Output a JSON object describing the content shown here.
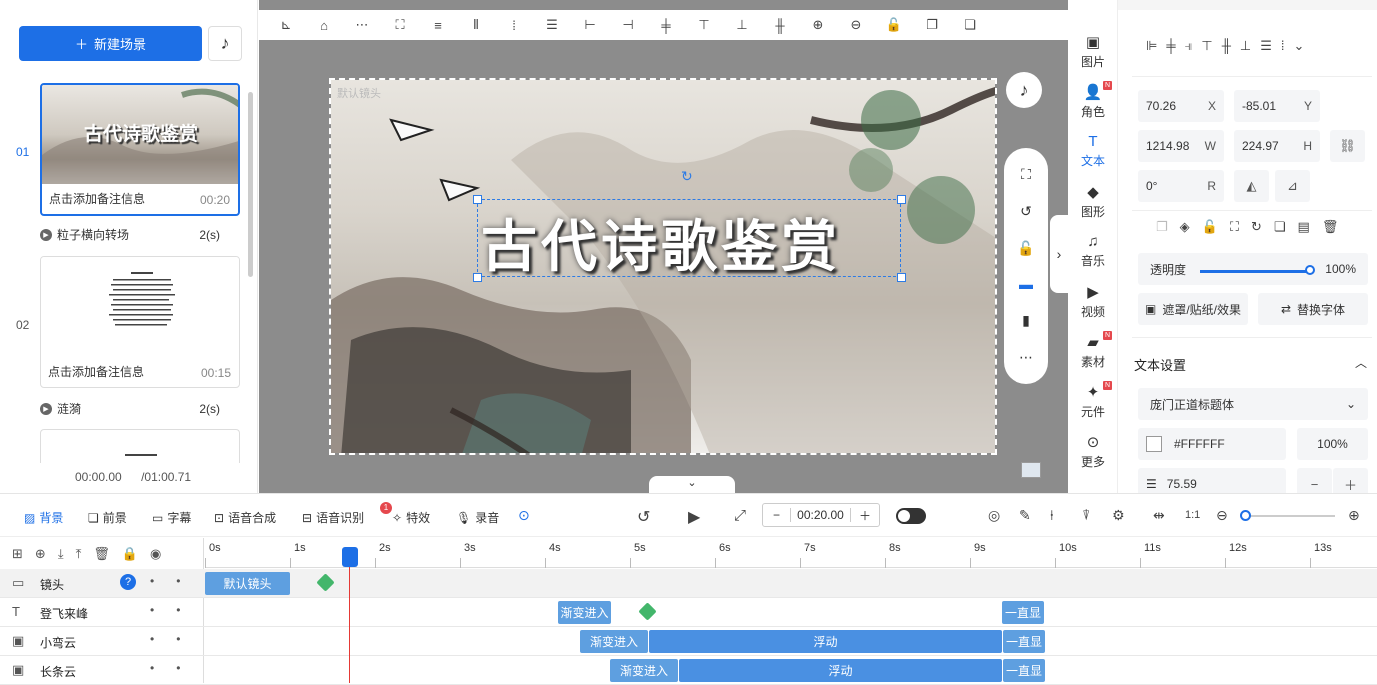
{
  "left": {
    "new_scene": "新建场景",
    "scenes": [
      {
        "num": "01",
        "title": "古代诗歌鉴赏",
        "note": "点击添加备注信息",
        "duration": "00:20"
      },
      {
        "num": "02",
        "note": "点击添加备注信息",
        "duration": "00:15"
      }
    ],
    "transitions": [
      {
        "name": "粒子横向转场",
        "duration": "2(s)"
      },
      {
        "name": "涟漪",
        "duration": "2(s)"
      }
    ],
    "time_current": "00:00.00",
    "time_total": "/01:00.71"
  },
  "canvas": {
    "camera_label": "默认镜头",
    "title_text": "古代诗歌鉴赏"
  },
  "categories": [
    {
      "label": "图片",
      "icon": "image-icon"
    },
    {
      "label": "角色",
      "icon": "person-icon",
      "badge": "N"
    },
    {
      "label": "文本",
      "icon": "text-icon",
      "active": true
    },
    {
      "label": "图形",
      "icon": "shape-icon"
    },
    {
      "label": "音乐",
      "icon": "music-icon"
    },
    {
      "label": "视频",
      "icon": "video-icon"
    },
    {
      "label": "素材",
      "icon": "folder-icon",
      "badge": "N"
    },
    {
      "label": "元件",
      "icon": "component-icon",
      "badge": "N"
    },
    {
      "label": "更多",
      "icon": "more-icon"
    }
  ],
  "props": {
    "x": "70.26",
    "x_unit": "X",
    "y": "-85.01",
    "y_unit": "Y",
    "w": "1214.98",
    "w_unit": "W",
    "h": "224.97",
    "h_unit": "H",
    "r": "0°",
    "r_unit": "R",
    "opacity_label": "透明度",
    "opacity_value": "100%",
    "opacity_fraction": 1.0,
    "mask_label": "遮罩/贴纸/效果",
    "replace_font": "替换字体",
    "text_settings": "文本设置",
    "font_name": "庞门正道标题体",
    "color_hex": "#FFFFFF",
    "color_opacity": "100%",
    "font_size": "75.59"
  },
  "timeline": {
    "tabs": [
      "背景",
      "前景",
      "字幕",
      "语音合成",
      "语音识别",
      "特效",
      "录音"
    ],
    "effects_badge": "1",
    "timecode": "00:20.00",
    "ticks": [
      "0s",
      "1s",
      "2s",
      "3s",
      "4s",
      "5s",
      "6s",
      "7s",
      "8s",
      "9s",
      "10s",
      "11s",
      "12s",
      "13s"
    ],
    "tracks": [
      {
        "name": "镜头",
        "clips": [
          {
            "label": "默认镜头"
          }
        ]
      },
      {
        "name": "登飞来峰",
        "clips": [
          {
            "label": "渐变进入"
          },
          {
            "label": "一直显"
          }
        ]
      },
      {
        "name": "小弯云",
        "clips": [
          {
            "label": "渐变进入"
          },
          {
            "label": "浮动"
          },
          {
            "label": "一直显"
          }
        ]
      },
      {
        "name": "长条云",
        "clips": [
          {
            "label": "渐变进入"
          },
          {
            "label": "浮动"
          },
          {
            "label": "一直显"
          }
        ]
      }
    ]
  },
  "colors": {
    "accent": "#1d6fe6",
    "clip": "#5e9fe0",
    "keyframe": "#43b66b",
    "playhead": "#e53935"
  }
}
